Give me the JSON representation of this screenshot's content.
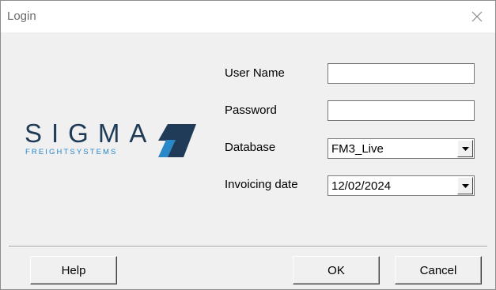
{
  "window": {
    "title": "Login",
    "close_icon": "close-icon"
  },
  "logo": {
    "wordmark": "SIGMA",
    "tagline": "FREIGHTSYSTEMS",
    "colors": {
      "wordmark": "#1f3b57",
      "tagline": "#2a87c8",
      "mark_dark": "#1f3b57",
      "mark_light": "#2a87c8"
    }
  },
  "form": {
    "username": {
      "label": "User Name",
      "value": ""
    },
    "password": {
      "label": "Password",
      "value": ""
    },
    "database": {
      "label": "Database",
      "value": "FM3_Live"
    },
    "invoicing_date": {
      "label": "Invoicing date",
      "value": "12/02/2024"
    }
  },
  "buttons": {
    "help": "Help",
    "ok": "OK",
    "cancel": "Cancel"
  }
}
